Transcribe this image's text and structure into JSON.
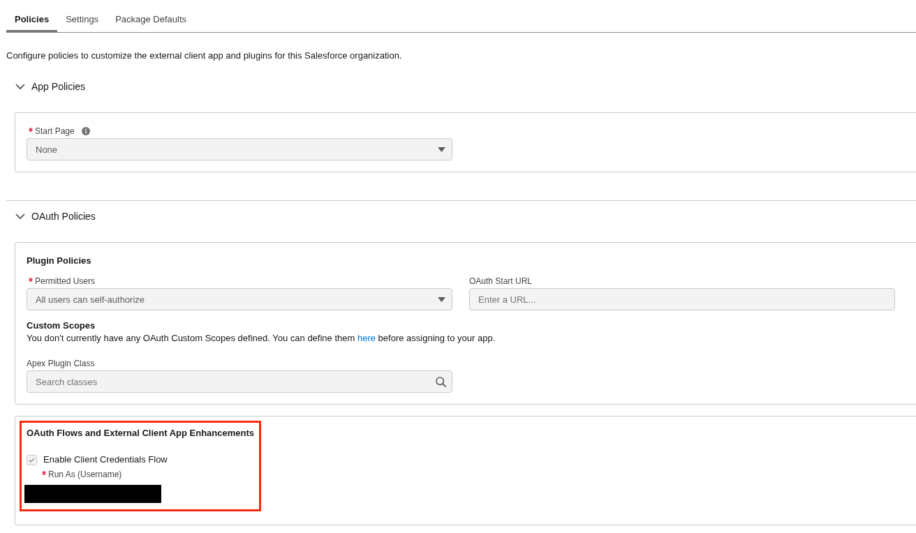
{
  "tabs": [
    {
      "label": "Policies",
      "selected": true
    },
    {
      "label": "Settings",
      "selected": false
    },
    {
      "label": "Package Defaults",
      "selected": false
    }
  ],
  "description": "Configure policies to customize the external client app and plugins for this Salesforce organization.",
  "sections": [
    {
      "title": "App Policies",
      "expanded": true,
      "cards": [
        {
          "items": [
            {
              "kind": "field_row",
              "fields": [
                {
                  "kind": "select",
                  "label": "Start Page",
                  "required": true,
                  "info": true,
                  "value": "None"
                }
              ]
            }
          ]
        }
      ]
    },
    {
      "title": "OAuth Policies",
      "expanded": true,
      "cards": [
        {
          "title": "Plugin Policies",
          "items": [
            {
              "kind": "field_row",
              "fields": [
                {
                  "kind": "select",
                  "label": "Permitted Users",
                  "required": true,
                  "value": "All users can self-authorize"
                },
                {
                  "kind": "input",
                  "label": "OAuth Start URL",
                  "placeholder": "Enter a URL..."
                }
              ]
            },
            {
              "kind": "note",
              "heading": "Custom Scopes",
              "text_before": "You don't currently have any OAuth Custom Scopes defined. You can define them ",
              "link": "here",
              "text_after": " before assigning to your app."
            },
            {
              "kind": "field_row",
              "fields": [
                {
                  "kind": "search",
                  "label": "Apex Plugin Class",
                  "placeholder": "Search classes"
                }
              ]
            }
          ]
        },
        {
          "title": "OAuth Flows and External Client App Enhancements",
          "highlighted": true,
          "items": [
            {
              "kind": "checkbox",
              "label": "Enable Client Credentials Flow",
              "checked": true,
              "disabled": true,
              "children": [
                {
                  "kind": "redacted",
                  "label": "Run As (Username)",
                  "required": true
                }
              ]
            }
          ]
        }
      ]
    }
  ]
}
